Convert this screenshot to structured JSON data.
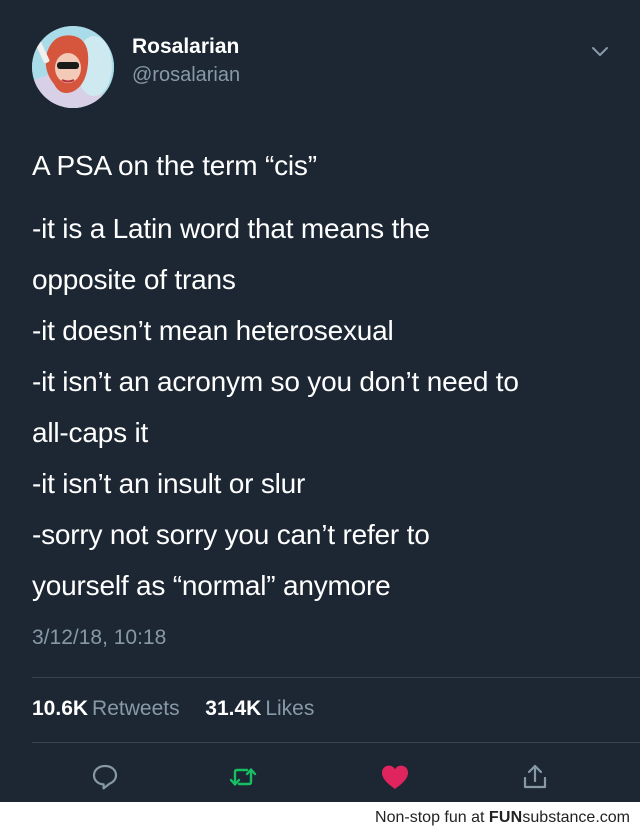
{
  "user": {
    "display_name": "Rosalarian",
    "handle": "@rosalarian"
  },
  "tweet": {
    "lines": [
      "A PSA on the term “cis”",
      "-it is a Latin word that means the",
      "opposite of trans",
      "-it doesn’t mean heterosexual",
      "-it isn’t an acronym so you don’t need to",
      "all-caps it",
      "-it isn’t an insult or slur",
      "-sorry not sorry you can’t refer to",
      "yourself as “normal” anymore"
    ],
    "timestamp": "3/12/18, 10:18"
  },
  "stats": {
    "retweets_count": "10.6K",
    "retweets_label": "Retweets",
    "likes_count": "31.4K",
    "likes_label": "Likes"
  },
  "actions": {
    "reply_icon": "reply-icon",
    "retweet_icon": "retweet-icon",
    "like_icon": "heart-icon",
    "share_icon": "share-icon"
  },
  "colors": {
    "background": "#1c2733",
    "secondary_text": "#8899a6",
    "retweet_green": "#17bf63",
    "like_red": "#e0245e"
  },
  "footer": {
    "prefix": "Non-stop fun at",
    "brand_bold": "FUN",
    "brand_rest": "substance",
    "suffix": ".com"
  }
}
